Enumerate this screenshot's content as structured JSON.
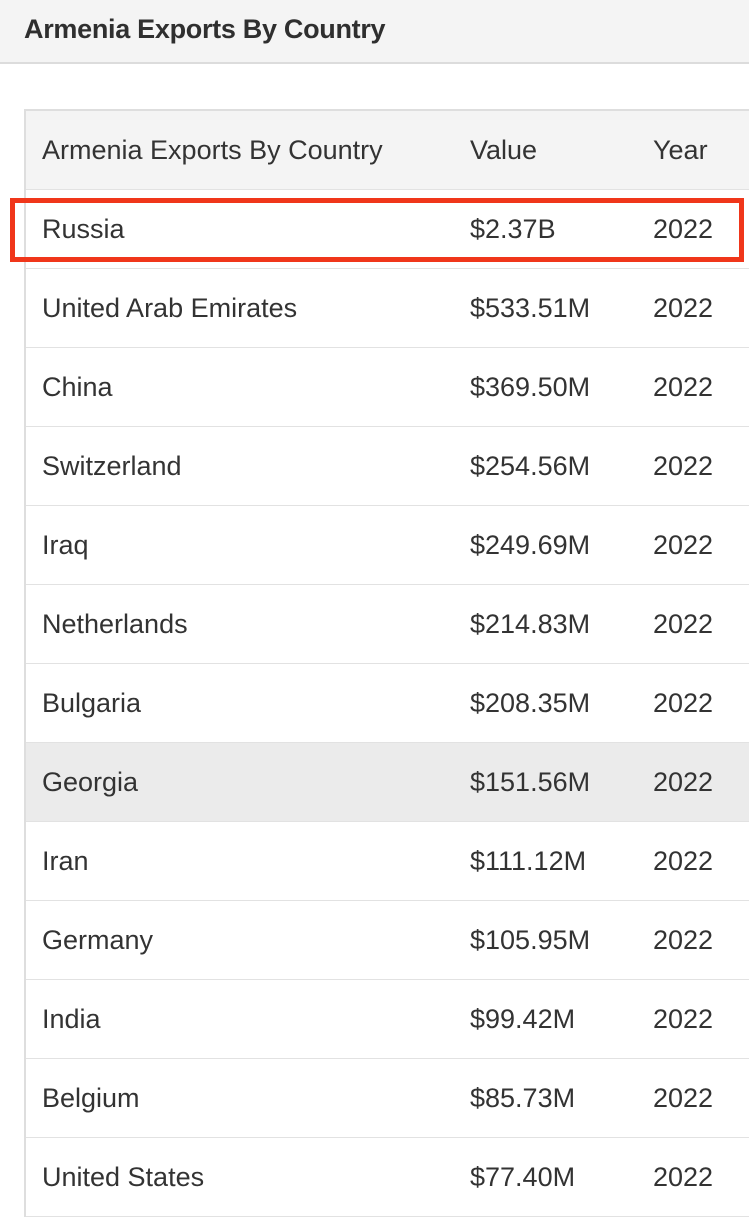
{
  "header": {
    "title": "Armenia Exports By Country"
  },
  "table": {
    "columns": [
      "Armenia Exports By Country",
      "Value",
      "Year"
    ],
    "rows": [
      {
        "country": "Russia",
        "value": "$2.37B",
        "year": "2022"
      },
      {
        "country": "United Arab Emirates",
        "value": "$533.51M",
        "year": "2022"
      },
      {
        "country": "China",
        "value": "$369.50M",
        "year": "2022"
      },
      {
        "country": "Switzerland",
        "value": "$254.56M",
        "year": "2022"
      },
      {
        "country": "Iraq",
        "value": "$249.69M",
        "year": "2022"
      },
      {
        "country": "Netherlands",
        "value": "$214.83M",
        "year": "2022"
      },
      {
        "country": "Bulgaria",
        "value": "$208.35M",
        "year": "2022"
      },
      {
        "country": "Georgia",
        "value": "$151.56M",
        "year": "2022"
      },
      {
        "country": "Iran",
        "value": "$111.12M",
        "year": "2022"
      },
      {
        "country": "Germany",
        "value": "$105.95M",
        "year": "2022"
      },
      {
        "country": "India",
        "value": "$99.42M",
        "year": "2022"
      },
      {
        "country": "Belgium",
        "value": "$85.73M",
        "year": "2022"
      },
      {
        "country": "United States",
        "value": "$77.40M",
        "year": "2022"
      }
    ],
    "highlighted_row_index": 7,
    "annotated_row_index": 0
  },
  "annotation": {
    "color": "#f0361a"
  }
}
